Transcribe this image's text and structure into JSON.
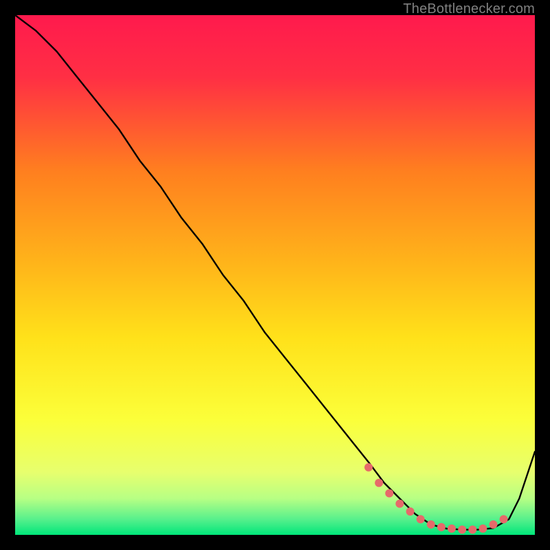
{
  "watermark": "TheBottlenecker.com",
  "chart_data": {
    "type": "line",
    "title": "",
    "xlabel": "",
    "ylabel": "",
    "xlim": [
      0,
      100
    ],
    "ylim": [
      0,
      100
    ],
    "grid": false,
    "legend": false,
    "background_gradient": {
      "top": "#ff1a4d",
      "mid_upper": "#ff9a1a",
      "mid": "#ffe11a",
      "mid_lower": "#f4ff5a",
      "band": "#9dff7d",
      "bottom": "#00e67a"
    },
    "series": [
      {
        "name": "curve",
        "color": "#000000",
        "x": [
          0,
          4,
          8,
          12,
          16,
          20,
          24,
          28,
          32,
          36,
          40,
          44,
          48,
          52,
          56,
          60,
          64,
          68,
          71,
          74,
          77,
          80,
          83,
          86,
          89,
          92,
          95,
          97,
          100
        ],
        "y": [
          100,
          97,
          93,
          88,
          83,
          78,
          72,
          67,
          61,
          56,
          50,
          45,
          39,
          34,
          29,
          24,
          19,
          14,
          10,
          7,
          4,
          2,
          1.2,
          1,
          1,
          1.3,
          3,
          7,
          16
        ]
      },
      {
        "name": "marker-dots",
        "color": "#e66a6a",
        "type": "scatter",
        "x": [
          68,
          70,
          72,
          74,
          76,
          78,
          80,
          82,
          84,
          86,
          88,
          90,
          92,
          94
        ],
        "y": [
          13,
          10,
          8,
          6,
          4.5,
          3,
          2,
          1.5,
          1.2,
          1.0,
          1.0,
          1.2,
          2,
          3
        ]
      }
    ]
  }
}
